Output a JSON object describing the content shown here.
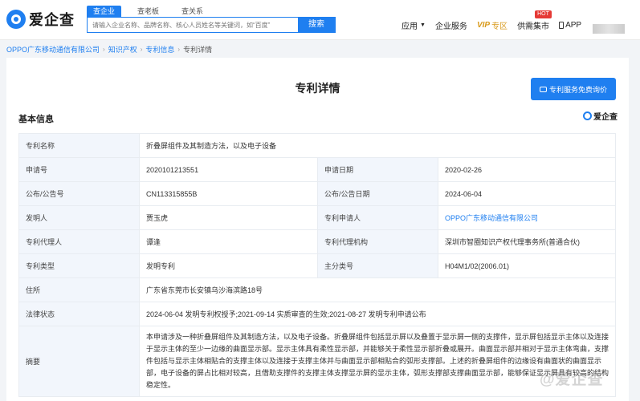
{
  "header": {
    "logo_text": "爱企查",
    "search_tabs": [
      "查企业",
      "查老板",
      "查关系"
    ],
    "search_placeholder": "请输入企业名称、品牌名称、核心人员姓名等关键词，如“百度”",
    "search_button": "搜索",
    "nav": {
      "apps": "应用",
      "enterprise_service": "企业服务",
      "vip": "VIP",
      "vip_sub": "专区",
      "supply_market": "供需集市",
      "hot_badge": "HOT",
      "app": "APP"
    }
  },
  "breadcrumb": {
    "company": "OPPO广东移动通信有限公司",
    "ip": "知识产权",
    "patent_info": "专利信息",
    "current": "专利详情"
  },
  "page": {
    "title": "专利详情",
    "inquiry_button": "专利服务免费询价",
    "section_title": "基本信息",
    "brand": "爱企查"
  },
  "fields": {
    "patent_name_label": "专利名称",
    "patent_name": "折叠屏组件及其制造方法，以及电子设备",
    "app_no_label": "申请号",
    "app_no": "2020101213551",
    "app_date_label": "申请日期",
    "app_date": "2020-02-26",
    "pub_no_label": "公布/公告号",
    "pub_no": "CN113315855B",
    "pub_date_label": "公布/公告日期",
    "pub_date": "2024-06-04",
    "inventor_label": "发明人",
    "inventor": "贾玉虎",
    "applicant_label": "专利申请人",
    "applicant": "OPPO广东移动通信有限公司",
    "agent_label": "专利代理人",
    "agent": "谭逢",
    "agency_label": "专利代理机构",
    "agency": "深圳市智圈知识产权代理事务所(普通合伙)",
    "type_label": "专利类型",
    "type": "发明专利",
    "class_label": "主分类号",
    "class": "H04M1/02(2006.01)",
    "address_label": "住所",
    "address": "广东省东莞市长安镇乌沙海滨路18号",
    "legal_label": "法律状态",
    "legal": "2024-06-04 发明专利权授予;2021-09-14 实质审查的生效;2021-08-27 发明专利申请公布",
    "abstract_label": "摘要",
    "abstract": "本申请涉及一种折叠屏组件及其制造方法，以及电子设备。折叠屏组件包括显示屏以及叠置于显示屏一侧的支撑件，显示屏包括显示主体以及连接于显示主体的至少一边缘的曲面显示部。显示主体具有柔性显示部，并能够关于柔性显示部折叠或展开。曲面显示部并相对于显示主体弯曲，支撑件包括与显示主体相贴合的支撑主体以及连接于支撑主体并与曲面显示部相贴合的弧形支撑部。上述的折叠屏组件的边缘设有曲面状的曲面显示部，电子设备的屏占比相对较高，且借助支撑件的支撑主体支撑显示屏的显示主体，弧形支撑部支撑曲面显示部，能够保证显示屏具有较高的结构稳定性。"
  },
  "watermark": "@爱企查"
}
